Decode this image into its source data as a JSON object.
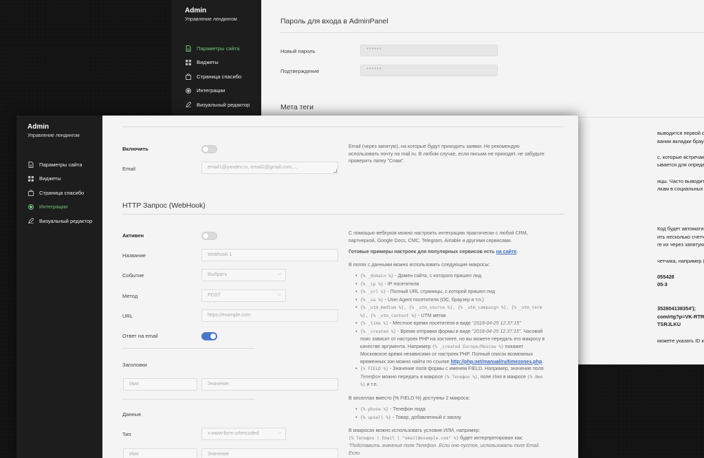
{
  "back": {
    "brand": {
      "title": "Admin",
      "subtitle": "Управление лендингом"
    },
    "nav": [
      {
        "label": "Параметры сайта",
        "icon": "file-icon",
        "active": true
      },
      {
        "label": "Виджеты",
        "icon": "grid-icon",
        "active": false
      },
      {
        "label": "Страница спасибо",
        "icon": "bag-icon",
        "active": false
      },
      {
        "label": "Интеграции",
        "icon": "circle-icon",
        "active": false
      },
      {
        "label": "Визуальный редактор",
        "icon": "pencil-icon",
        "active": false
      }
    ],
    "password_title": "Пароль для входа в AdminPanel",
    "new_password_label": "Новый пароль",
    "new_password_value": "******",
    "confirm_label": "Подтверждение",
    "confirm_value": "******",
    "meta_title": "Мета теги",
    "right_text": [
      "выводится первой строчкой в результатах поиска G",
      "вании вкладки браузера.",
      "",
      "c, которые встречаются на странице. Не влияет на",
      "ывается для определения тематики страницы.",
      "",
      "ицы. Часто выводится поисковиками под ссылкой",
      "лкам в социальных сетях.",
      "",
      "",
      "",
      "",
      "Код будет автоматически вставлен на все страни",
      "ить несколько счетчиков одной системы (наприме",
      "ге их через запятую.",
      "",
      "четчика, например (нужная часть выделена):",
      "",
      "055428",
      "05-3",
      "",
      "",
      "352804138354');",
      "com/rtg?p=VK-RTRG-221699-65Gt",
      "TSRJLKU",
      "",
      "можете указать ID контейнера optimize (для A/B"
    ]
  },
  "front": {
    "brand": {
      "title": "Admin",
      "subtitle": "Управление лендингом"
    },
    "nav": [
      {
        "label": "Параметры сайта",
        "icon": "file-icon",
        "active": false
      },
      {
        "label": "Виджеты",
        "icon": "grid-icon",
        "active": false
      },
      {
        "label": "Страница спасибо",
        "icon": "bag-icon",
        "active": false
      },
      {
        "label": "Интеграции",
        "icon": "circle-icon",
        "active": true
      },
      {
        "label": "Визуальный редактор",
        "icon": "pencil-icon",
        "active": false
      }
    ],
    "email_section": {
      "enable_label": "Включить",
      "enable_on": false,
      "email_label": "Email",
      "email_placeholder": "email1@yandex.ru, email2@gmail.com, ...",
      "help": "Email (через запятую), на которые будут приходить заявки. Не рекомендую использовать почту на mail.ru. В любом случае, если письма не приходят, не забудьте проверить папку \"Спам\"."
    },
    "webhook": {
      "title": "HTTP Запрос (WebHook)",
      "active_label": "Активен",
      "active_on": false,
      "name_label": "Название",
      "name_placeholder": "Webhook 1",
      "event_label": "Событие",
      "event_value": "Выбрать",
      "method_label": "Метод",
      "method_value": "POST",
      "url_label": "URL",
      "url_placeholder": "https://example.com",
      "email_reply_label": "Ответ на email",
      "email_reply_on": true,
      "headers_label": "Заголовки",
      "header_name_placeholder": "Имя",
      "header_value_placeholder": "Значение",
      "data_label": "Данные",
      "type_label": "Тип",
      "type_value": "x-www-form-urlencoded",
      "data_name_placeholder": "Имя",
      "data_value_placeholder": "Значение"
    },
    "help": {
      "intro": "С помощью вебхуков можно настроить интеграцию практически с любой CRM, партнеркой, Google Docs, CMC, Telegram, Airtable и другими сервисами.",
      "ready_prefix": "Готовые примеры настроек для популярных сервисов есть ",
      "ready_link": "на сайте",
      "ready_suffix": ".",
      "macros_intro": "В полях с данными можно использовать следующие макросы:",
      "macros": [
        {
          "code": "{% _domain %}",
          "text": " - Домен сайта, с которого пришел лид"
        },
        {
          "code": "{% _ip %}",
          "text": " - IP посетителя"
        },
        {
          "code": "{% _url %}",
          "text": " - Полный URL страницы, с которой пришел лид"
        },
        {
          "code": "{% _ua %}",
          "text": " - User Agent посетителя (ОС, браузер и т.п.)"
        },
        {
          "code": "{% _utm_medium %}, {% _utm_source %}, {% _utm_campaign %}, {% _utm_term %}, {% _utm_content %}",
          "text": " - UTM метки"
        },
        {
          "code": "{% _time %}",
          "text": " - Местное время посетителя в виде ",
          "italic": "\"2018-04-25 12:37:15\""
        },
        {
          "code": "{% _created %}",
          "text": " - Время отправки формы в виде ",
          "italic": "\"2018-04-25 12:37:15\"",
          "tail": ". Часовой пояс зависит от настроек PHP на хостинге, но вы можете передать его макросу в качестве аргумента. Например ",
          "code2": "{% _created Europe/Moscow %}",
          "tail2": " покажет Московское время независимо от настроек PHP. Полный список возможных временных зон можно найти по ссылке ",
          "link": "http://php.net/manual/ru/timezones.php",
          "tail3": "."
        },
        {
          "code": "{% FIELD %}",
          "text": " - Значение поля формы с именем FIELD. Например, значение поля ",
          "italic": "Телефон",
          "tail": " можно передать в макросе ",
          "code2": "{% Телефон %}",
          "tail2": ", поле ",
          "italic2": "Имя",
          "tail3": " в макросе ",
          "code3": "{% Имя %}",
          "tail4": " и т.п."
        }
      ],
      "upsell_intro": "В апселлах вместо {% FIELD %} доступны 2 макроса:",
      "upsell_macros": [
        {
          "code": "{% phone %}",
          "text": " - Телефон лида"
        },
        {
          "code": "{% upsell %}",
          "text": " - Товар, добавленный к заказу"
        }
      ],
      "or_intro": "В макросах можно использовать условие ИЛИ, например:",
      "or_code": "{% Телефон | Email | \"email@example.com\" %}",
      "or_text": " будет интерпретирован как:",
      "or_italic": "\"Подставить значение поля Телефон. Если оно пустое, использовать поле Email. Если"
    }
  }
}
